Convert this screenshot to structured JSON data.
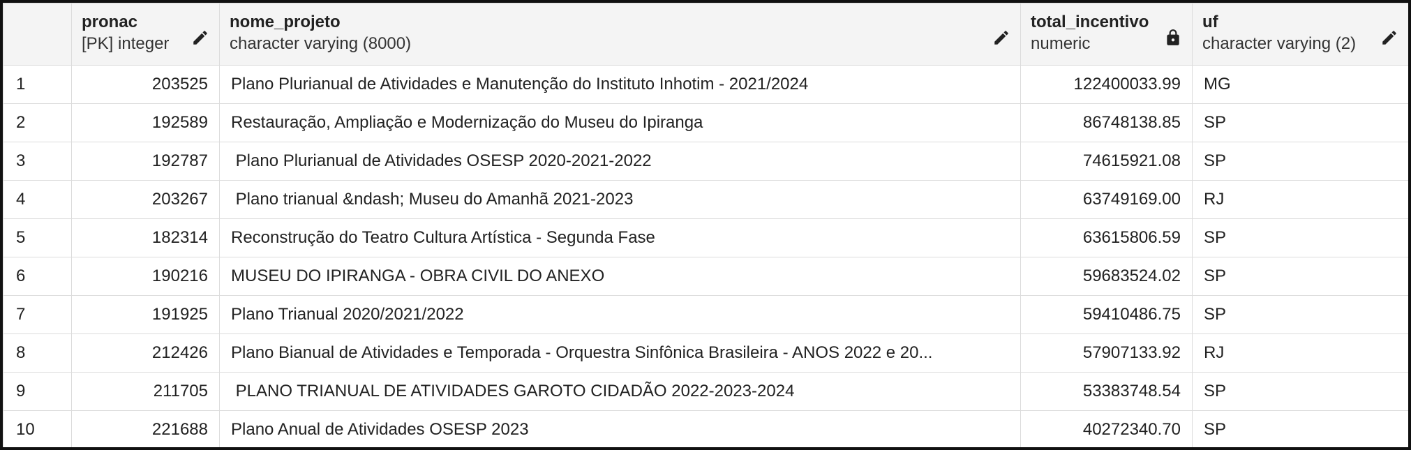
{
  "columns": [
    {
      "name": "pronac",
      "type": "[PK] integer",
      "icon": "pencil-icon"
    },
    {
      "name": "nome_projeto",
      "type": "character varying (8000)",
      "icon": "pencil-icon"
    },
    {
      "name": "total_incentivo",
      "type": "numeric",
      "icon": "lock-icon"
    },
    {
      "name": "uf",
      "type": "character varying (2)",
      "icon": "pencil-icon"
    }
  ],
  "rows": [
    {
      "n": "1",
      "pronac": "203525",
      "nome_projeto": "Plano Plurianual de Atividades e Manutenção do Instituto Inhotim - 2021/2024",
      "total_incentivo": "122400033.99",
      "uf": "MG"
    },
    {
      "n": "2",
      "pronac": "192589",
      "nome_projeto": "Restauração, Ampliação e Modernização do Museu do Ipiranga",
      "total_incentivo": "86748138.85",
      "uf": "SP"
    },
    {
      "n": "3",
      "pronac": "192787",
      "nome_projeto": " Plano Plurianual de Atividades OSESP 2020-2021-2022",
      "total_incentivo": "74615921.08",
      "uf": "SP"
    },
    {
      "n": "4",
      "pronac": "203267",
      "nome_projeto": " Plano trianual &ndash; Museu do Amanhã 2021-2023",
      "total_incentivo": "63749169.00",
      "uf": "RJ"
    },
    {
      "n": "5",
      "pronac": "182314",
      "nome_projeto": "Reconstrução do Teatro Cultura Artística - Segunda Fase",
      "total_incentivo": "63615806.59",
      "uf": "SP"
    },
    {
      "n": "6",
      "pronac": "190216",
      "nome_projeto": "MUSEU DO IPIRANGA - OBRA CIVIL DO ANEXO",
      "total_incentivo": "59683524.02",
      "uf": "SP"
    },
    {
      "n": "7",
      "pronac": "191925",
      "nome_projeto": "Plano Trianual 2020/2021/2022",
      "total_incentivo": "59410486.75",
      "uf": "SP"
    },
    {
      "n": "8",
      "pronac": "212426",
      "nome_projeto": "Plano Bianual de Atividades e Temporada - Orquestra Sinfônica Brasileira - ANOS 2022 e 20...",
      "total_incentivo": "57907133.92",
      "uf": "RJ"
    },
    {
      "n": "9",
      "pronac": "211705",
      "nome_projeto": " PLANO TRIANUAL DE ATIVIDADES GAROTO CIDADÃO 2022-2023-2024",
      "total_incentivo": "53383748.54",
      "uf": "SP"
    },
    {
      "n": "10",
      "pronac": "221688",
      "nome_projeto": "Plano Anual de Atividades OSESP 2023",
      "total_incentivo": "40272340.70",
      "uf": "SP"
    }
  ]
}
